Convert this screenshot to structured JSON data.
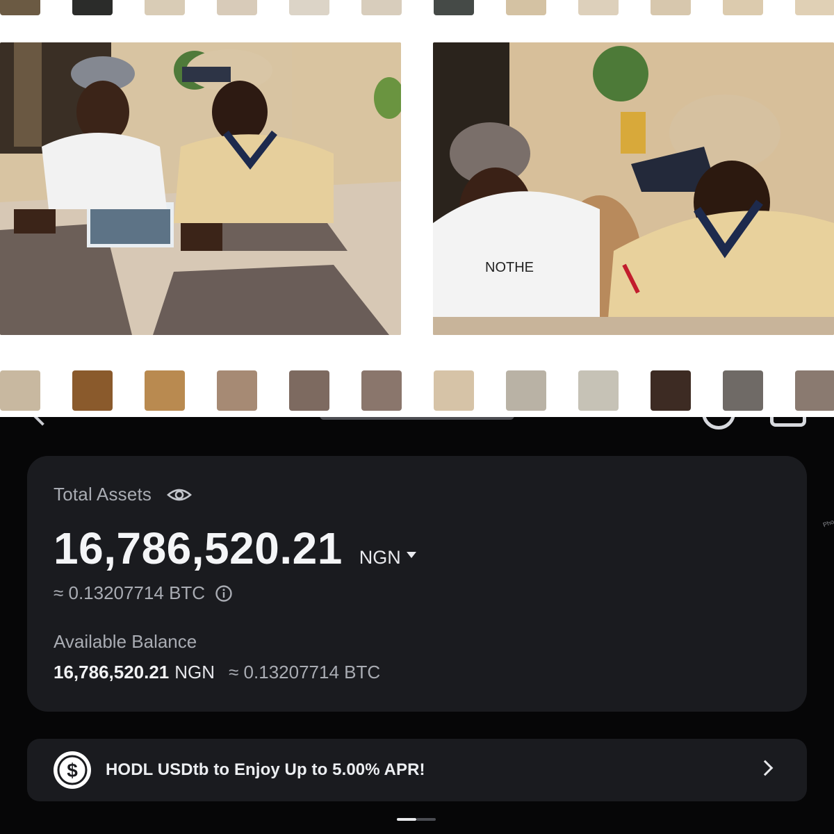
{
  "film": {
    "sprocket_colors_top": [
      "#6b5a43",
      "#2b2c2a",
      "#d9ccb6",
      "#d8cbb9",
      "#dcd4c7",
      "#d8cdbc",
      "#454a47",
      "#d4c2a3",
      "#ddd0bb",
      "#d7c7ad",
      "#dccbae",
      "#e0d0b5"
    ],
    "sprocket_colors_bottom": [
      "#c8b8a0",
      "#8a5a2c",
      "#b98a50",
      "#a68a74",
      "#7d6a60",
      "#8a766c",
      "#d6c3a7",
      "#b9b2a5",
      "#c6c2b6",
      "#3d2b23",
      "#6f6a66",
      "#8a7a70"
    ]
  },
  "header": {
    "title_clipped": ""
  },
  "assets": {
    "label": "Total Assets",
    "amount": "16,786,520.21",
    "currency": "NGN",
    "btc_equiv": "≈ 0.13207714 BTC"
  },
  "available": {
    "label": "Available Balance",
    "amount": "16,786,520.21",
    "currency": "NGN",
    "btc_equiv": "≈ 0.13207714 BTC"
  },
  "promo": {
    "text": "HODL USDtb to Enjoy Up to 5.00% APR!"
  },
  "side_mark": "Pho"
}
